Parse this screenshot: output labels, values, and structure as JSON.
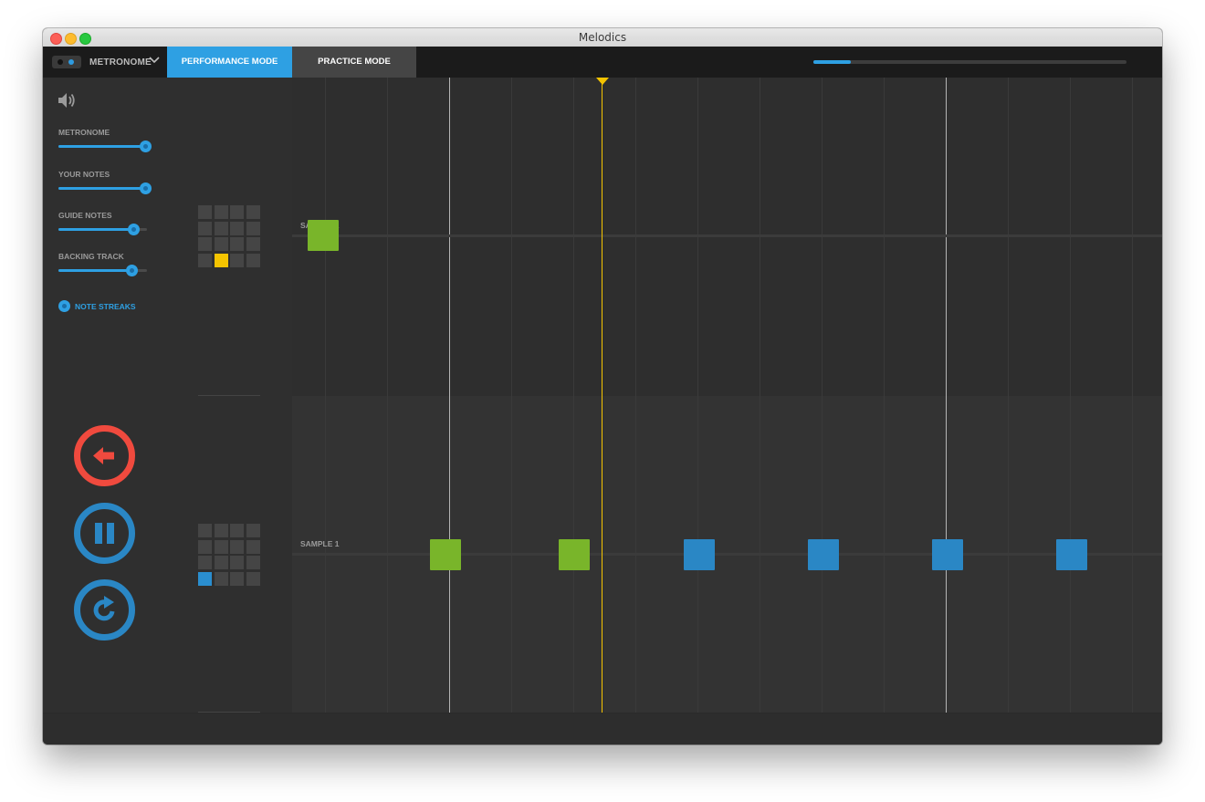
{
  "window": {
    "title": "Melodics"
  },
  "toolbar": {
    "metronome_label": "METRONOME",
    "tabs": [
      {
        "label": "PERFORMANCE MODE",
        "active": true
      },
      {
        "label": "PRACTICE MODE",
        "active": false
      }
    ],
    "progress_fraction": 0.12
  },
  "sidebar": {
    "volume_icon": "speaker-icon",
    "sliders": [
      {
        "label": "METRONOME",
        "value": 0.98
      },
      {
        "label": "YOUR NOTES",
        "value": 0.98
      },
      {
        "label": "GUIDE NOTES",
        "value": 0.85
      },
      {
        "label": "BACKING TRACK",
        "value": 0.82
      }
    ],
    "note_streaks_label": "NOTE STREAKS",
    "controls": [
      {
        "name": "back-button",
        "icon": "arrow-left-icon",
        "color": "#f04a3e"
      },
      {
        "name": "pause-button",
        "icon": "pause-icon",
        "color": "#2a87c5"
      },
      {
        "name": "restart-button",
        "icon": "restart-icon",
        "color": "#2a87c5"
      }
    ]
  },
  "lanes": [
    {
      "label": "SAMPLE 2",
      "pad_highlight": {
        "row": 3,
        "col": 1,
        "color": "#f5c400"
      }
    },
    {
      "label": "SAMPLE 1",
      "pad_highlight": {
        "row": 3,
        "col": 0,
        "color": "#2a8ecf"
      }
    }
  ],
  "colors": {
    "accent": "#2ea0e3",
    "hit": "#79b52a",
    "upcoming": "#2a87c5",
    "playhead": "#f5c400",
    "back": "#f04a3e"
  }
}
